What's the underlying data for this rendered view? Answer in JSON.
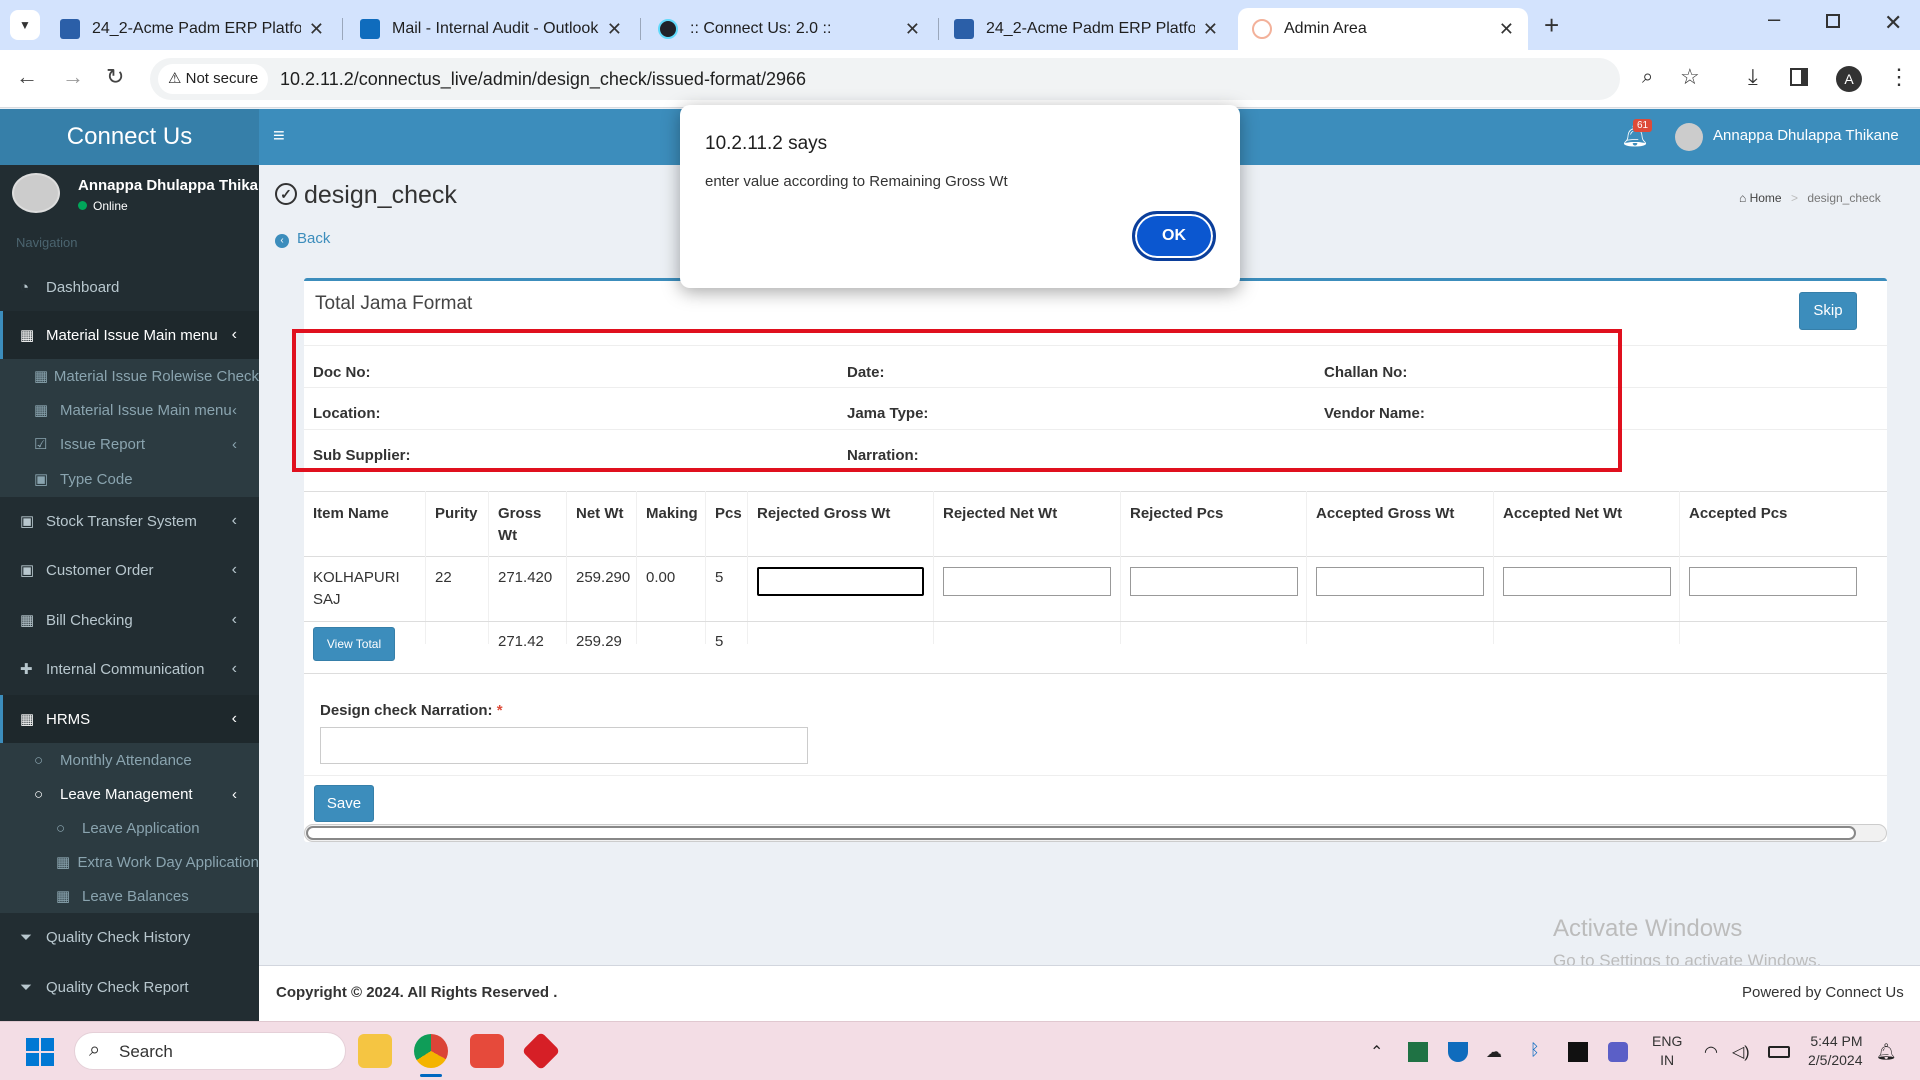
{
  "browser": {
    "tabs": [
      {
        "title": "24_2-Acme Padm ERP Platform",
        "icon": "erp-favicon",
        "active": false
      },
      {
        "title": "Mail - Internal Audit - Outlook",
        "icon": "outlook-favicon",
        "active": false
      },
      {
        "title": ":: Connect Us: 2.0 ::",
        "icon": "react-favicon",
        "active": false
      },
      {
        "title": "24_2-Acme Padm ERP Platform",
        "icon": "erp-favicon",
        "active": false
      },
      {
        "title": "Admin Area",
        "icon": "admin-favicon",
        "active": true
      }
    ],
    "security_label": "Not secure",
    "url": "10.2.11.2/connectus_live/admin/design_check/issued-format/2966",
    "profile_initial": "A"
  },
  "app": {
    "brand": "Connect Us",
    "user_name": "Annappa Dhulappa Thikane",
    "user_status": "Online",
    "nav_header": "Navigation",
    "notification_count": "61",
    "topbar_user": "Annappa Dhulappa Thikane"
  },
  "sidebar": {
    "items": [
      {
        "label": "Dashboard",
        "icon": "dashboard-icon"
      },
      {
        "label": "Material Issue Main menu",
        "icon": "table-icon"
      },
      {
        "label": "Material Issue Rolewise Check",
        "icon": "table-icon"
      },
      {
        "label": "Material Issue Main menu",
        "icon": "table-icon"
      },
      {
        "label": "Issue Report",
        "icon": "checkbox-icon"
      },
      {
        "label": "Type Code",
        "icon": "money-icon"
      },
      {
        "label": "Stock Transfer System",
        "icon": "money-icon"
      },
      {
        "label": "Customer Order",
        "icon": "money-icon"
      },
      {
        "label": "Bill Checking",
        "icon": "table-icon"
      },
      {
        "label": "Internal Communication",
        "icon": "plus-icon"
      },
      {
        "label": "HRMS",
        "icon": "table-icon"
      },
      {
        "label": "Monthly Attendance",
        "icon": "circle-icon"
      },
      {
        "label": "Leave Management",
        "icon": "circle-icon"
      },
      {
        "label": "Leave Application",
        "icon": "circle-icon"
      },
      {
        "label": "Extra Work Day Application",
        "icon": "table-icon"
      },
      {
        "label": "Leave Balances",
        "icon": "table-icon"
      },
      {
        "label": "Quality Check History",
        "icon": "filter-icon"
      },
      {
        "label": "Quality Check Report",
        "icon": "filter-icon"
      }
    ]
  },
  "page": {
    "title": "design_check",
    "back_label": "Back",
    "breadcrumb_home": "Home",
    "breadcrumb_current": "design_check",
    "box_title": "Total Jama Format",
    "skip_label": "Skip"
  },
  "info_fields": {
    "doc_no": "Doc No:",
    "date": "Date:",
    "challan_no": "Challan No:",
    "location": "Location:",
    "jama_type": "Jama Type:",
    "vendor_name": "Vendor Name:",
    "sub_supplier": "Sub Supplier:",
    "narration": "Narration:"
  },
  "table": {
    "headers": {
      "item_name": "Item Name",
      "purity": "Purity",
      "gross_wt_1": "Gross",
      "gross_wt_2": "Wt",
      "net_wt": "Net Wt",
      "making": "Making",
      "pcs": "Pcs",
      "rejected_gross_wt": "Rejected Gross Wt",
      "rejected_net_wt": "Rejected Net Wt",
      "rejected_pcs": "Rejected Pcs",
      "accepted_gross_wt": "Accepted Gross Wt",
      "accepted_net_wt": "Accepted Net Wt",
      "accepted_pcs": "Accepted Pcs"
    },
    "row": {
      "item_name_1": "KOLHAPURI",
      "item_name_2": "SAJ",
      "purity": "22",
      "gross_wt": "271.420",
      "net_wt": "259.290",
      "making": "0.00",
      "pcs": "5"
    },
    "totals": {
      "view_total_label": "View Total",
      "gross_wt": "271.42",
      "net_wt": "259.29",
      "pcs": "5"
    }
  },
  "form": {
    "narration_label": "Design check Narration:",
    "required_mark": "*",
    "narration_value": "",
    "save_label": "Save"
  },
  "footer": {
    "copyright": "Copyright © 2024. All Rights Reserved .",
    "powered": "Powered by Connect Us"
  },
  "watermark": {
    "line1": "Activate Windows",
    "line2": "Go to Settings to activate Windows."
  },
  "dialog": {
    "title": "10.2.11.2 says",
    "message": "enter value according to Remaining Gross Wt",
    "ok_label": "OK"
  },
  "taskbar": {
    "search_placeholder": "Search",
    "lang_1": "ENG",
    "lang_2": "IN",
    "time": "5:44 PM",
    "date": "2/5/2024"
  },
  "colors": {
    "primary": "#3c8dbc",
    "sidebar": "#222d32",
    "highlight_border": "#e0101e"
  }
}
